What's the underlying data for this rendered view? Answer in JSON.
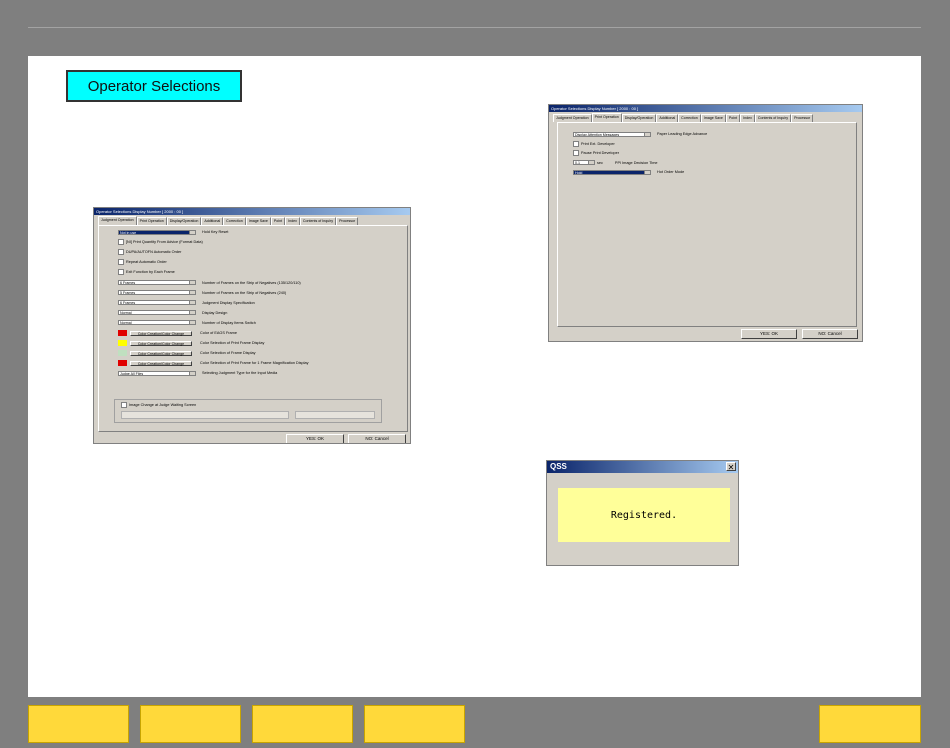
{
  "slide": {
    "title": "Operator Selections"
  },
  "dialog_a": {
    "title": "Operator Selections      Display Number [ 2000 : 00 ]",
    "tabs": [
      "Judgment Operation",
      "Print Operation",
      "Display/Operation",
      "Additional",
      "Correction",
      "Image Save",
      "Point",
      "Index",
      "Contents of Inquiry",
      "Processor"
    ],
    "rows": [
      {
        "kind": "select",
        "value": "Not in use",
        "highlight": true,
        "label": "Hold Key Reset"
      },
      {
        "kind": "check",
        "label": "[NI] Print Quantity From Advice (Format Data)"
      },
      {
        "kind": "check",
        "label": "DUPA/AUTOFN Automatic Order"
      },
      {
        "kind": "check",
        "label": "Repeat Automatic Order"
      },
      {
        "kind": "check",
        "label": "Exit Function by Each Frame"
      },
      {
        "kind": "select",
        "value": "6 Frames",
        "label": "Number of Frames on the Strip of Negatives (135/120/110)"
      },
      {
        "kind": "select",
        "value": "5 Frames",
        "label": "Number of Frames on the Strip of Negatives (240)"
      },
      {
        "kind": "select",
        "value": "6 Frames",
        "label": "Judgment Display Specification"
      },
      {
        "kind": "select",
        "value": "Normal",
        "label": "Display Design"
      },
      {
        "kind": "select",
        "value": "Normal",
        "label": "Number of Display Items Switch"
      },
      {
        "kind": "color",
        "swatch": "#e00000",
        "button": "Color Creation/Color Change",
        "label": "Color of EAGS Frame"
      },
      {
        "kind": "color",
        "swatch": "#ffff00",
        "button": "Color Creation/Color Change",
        "label": "Color Selection of Print Frame Display"
      },
      {
        "kind": "color",
        "swatch": "#c0e0c0",
        "button": "Color Creation/Color Change",
        "label": "Color Selection of Frame Display"
      },
      {
        "kind": "color",
        "swatch": "#e00000",
        "button": "Color Creation/Color Change",
        "label": "Color Selection of Print Frame for 1 Frame Magnification Display"
      },
      {
        "kind": "select",
        "value": "Judge All Files",
        "label": "Selecting Judgment Type for the Input Media"
      }
    ],
    "group_check": "Image Change at Judge Waiting Screen",
    "buttons": {
      "ok": "YES: OK",
      "cancel": "NO: Cancel"
    }
  },
  "dialog_b": {
    "title": "Operator Selections      Display Number [ 2000 : 00 ]",
    "tabs": [
      "Judgment Operation",
      "Print Operation",
      "Display/Operation",
      "Additional",
      "Correction",
      "Image Save",
      "Point",
      "Index",
      "Contents of Inquiry",
      "Processor"
    ],
    "rows": [
      {
        "kind": "select",
        "value": "Display Attention Messages",
        "label": "Paper Leading Edge Advance"
      },
      {
        "kind": "check",
        "label": "Print Ext. Developer"
      },
      {
        "kind": "check",
        "label": "Pause Print Developer"
      },
      {
        "kind": "spin",
        "value": "0.1",
        "unit": "sec",
        "label": "PPI Image Decision Time"
      },
      {
        "kind": "select",
        "value": "Hold",
        "highlight": true,
        "label": "Hot Order Mode"
      }
    ],
    "buttons": {
      "ok": "YES: OK",
      "cancel": "NO: Cancel"
    }
  },
  "qss_dialog": {
    "title": "QSS",
    "close": "✕",
    "message": "Registered."
  },
  "colors": {
    "background": "#7f7f7f",
    "slide": "#ffffff",
    "title_box": "#00ffff",
    "nav_button": "#ffd93a",
    "message_box": "#ffff99"
  },
  "nav": {
    "buttons": [
      "",
      "",
      "",
      "",
      ""
    ]
  }
}
